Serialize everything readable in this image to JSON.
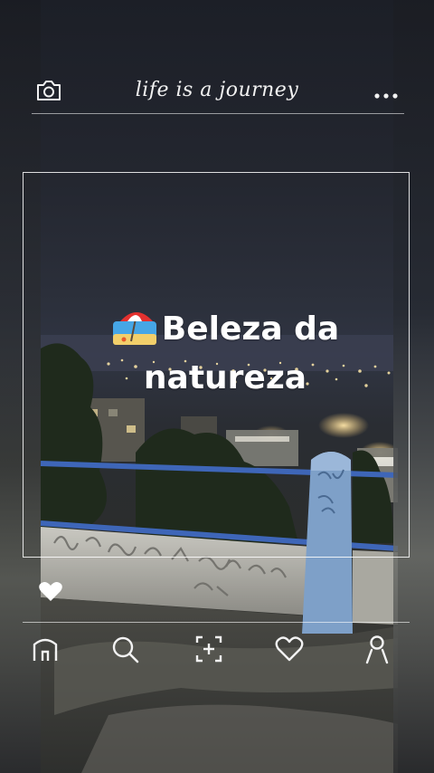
{
  "header": {
    "title": "life is a journey",
    "camera_icon": "camera-icon",
    "more_icon": "more-dots-icon"
  },
  "post": {
    "caption": "Beleza da natureza",
    "caption_emoji": "beach-umbrella-emoji",
    "like_icon": "heart-icon"
  },
  "bottom_nav": {
    "items": [
      {
        "icon": "home-icon"
      },
      {
        "icon": "search-icon"
      },
      {
        "icon": "add-post-icon"
      },
      {
        "icon": "heart-outline-icon"
      },
      {
        "icon": "profile-icon"
      }
    ]
  },
  "colors": {
    "foreground": "#ffffff",
    "night_sky": "#2b2f3a",
    "railing_blue": "#3e66b8",
    "city_light": "#f5d58a"
  }
}
